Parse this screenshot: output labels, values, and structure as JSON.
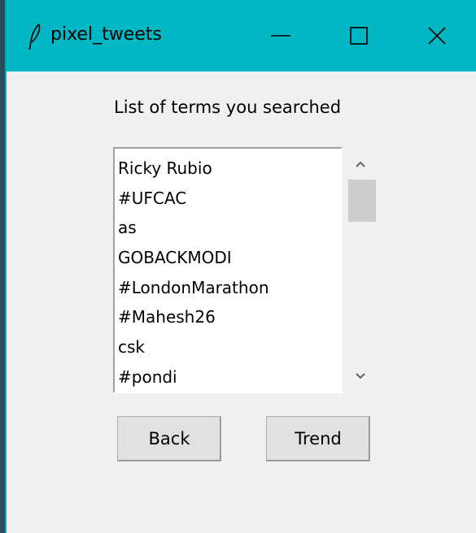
{
  "window": {
    "title": "pixel_tweets",
    "titlebar_color": "#00b7c3",
    "icon": "feather-icon",
    "controls": {
      "minimize_icon": "minimize-icon",
      "maximize_icon": "maximize-icon",
      "close_icon": "close-icon"
    }
  },
  "main": {
    "heading": "List of terms you searched",
    "list": {
      "items": [
        "Ricky Rubio",
        "#UFCAC",
        "as",
        "GOBACKMODI",
        "#LondonMarathon",
        "#Mahesh26",
        "csk",
        "#pondi"
      ],
      "scrollbar": {
        "up_icon": "chevron-up-icon",
        "down_icon": "chevron-down-icon"
      }
    },
    "buttons": {
      "back_label": "Back",
      "trend_label": "Trend"
    }
  }
}
